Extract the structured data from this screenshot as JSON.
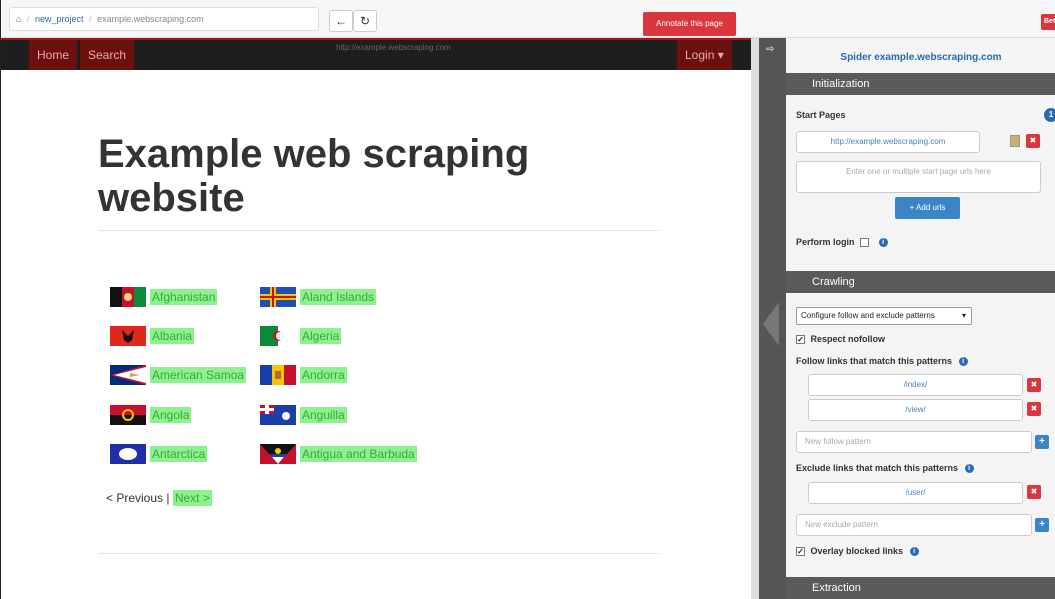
{
  "topbar": {
    "breadcrumb": {
      "project": "new_project",
      "site": "example.webscraping.com"
    },
    "back_icon": "arrow-left",
    "refresh_icon": "refresh",
    "annotate_label": "Annotate this page",
    "beta_label": "Bet"
  },
  "site": {
    "nav": {
      "home": "Home",
      "search": "Search",
      "url": "http://example.webscraping.com",
      "login": "Login ▾"
    },
    "title": "Example web scraping website",
    "countries": [
      {
        "name": "Afghanistan"
      },
      {
        "name": "Aland Islands"
      },
      {
        "name": "Albania"
      },
      {
        "name": "Algeria"
      },
      {
        "name": "American Samoa"
      },
      {
        "name": "Andorra"
      },
      {
        "name": "Angola"
      },
      {
        "name": "Anguilla"
      },
      {
        "name": "Antarctica"
      },
      {
        "name": "Antigua and Barbuda"
      }
    ],
    "pager": {
      "previous": "< Previous",
      "separator": "|",
      "next": "Next >"
    }
  },
  "panel": {
    "title": "Spider example.webscraping.com",
    "initialization": {
      "header": "Initialization",
      "start_pages_label": "Start Pages",
      "start_pages_count": "1",
      "start_url": "http://example.webscraping.com",
      "urls_placeholder": "Enter one or multiple start page urls here",
      "add_urls": "+ Add urls",
      "perform_login": "Perform login"
    },
    "crawling": {
      "header": "Crawling",
      "select_value": "Configure follow and exclude patterns",
      "respect_nofollow": "Respect nofollow",
      "follow_label": "Follow links that match this patterns",
      "follow_patterns": [
        "/index/",
        "/view/"
      ],
      "follow_placeholder": "New follow pattern",
      "exclude_label": "Exclude links that match this patterns",
      "exclude_patterns": [
        "/user/"
      ],
      "exclude_placeholder": "New exclude pattern",
      "overlay_blocked": "Overlay blocked links"
    },
    "extraction": {
      "header": "Extraction"
    }
  },
  "colors": {
    "accent_red": "#d9363e",
    "accent_blue": "#2a6ab0",
    "highlight_green": "#8df28d"
  }
}
